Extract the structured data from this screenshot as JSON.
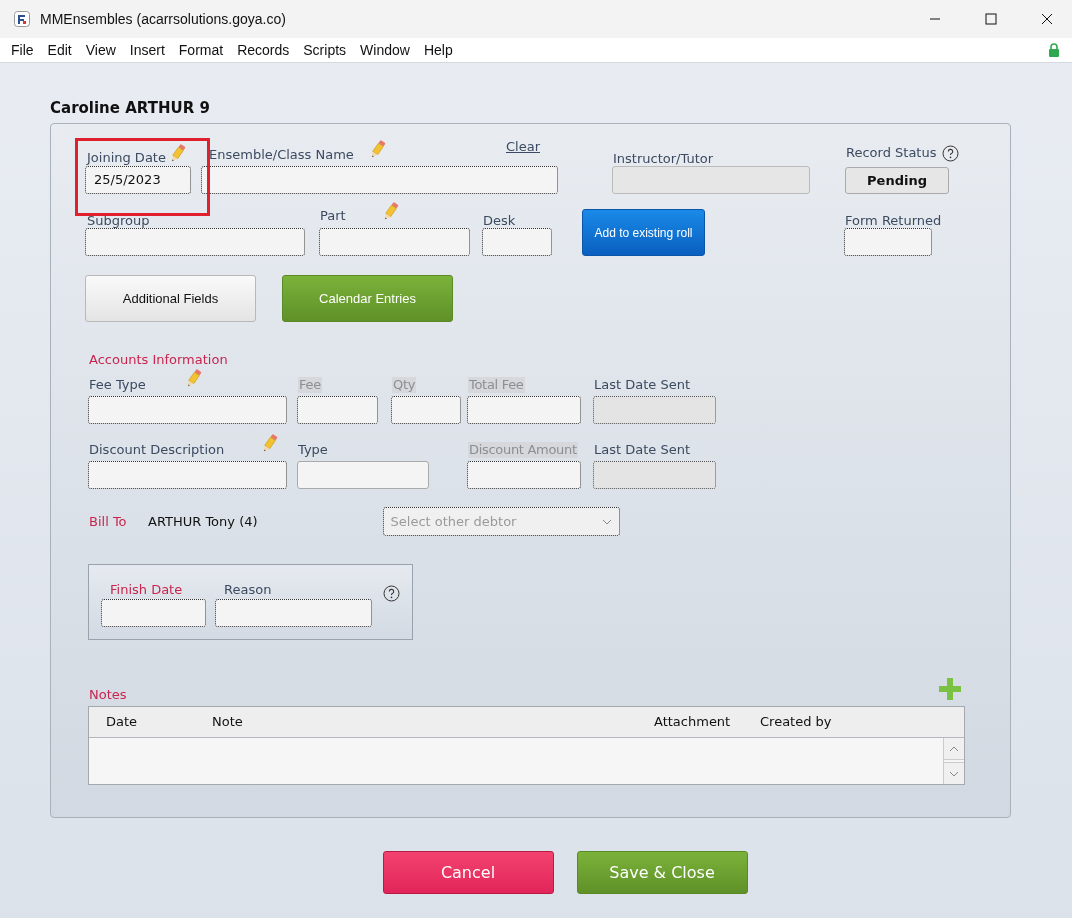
{
  "window": {
    "title": "MMEnsembles (acarrsolutions.goya.co)"
  },
  "menu": [
    "File",
    "Edit",
    "View",
    "Insert",
    "Format",
    "Records",
    "Scripts",
    "Window",
    "Help"
  ],
  "record_title": "Caroline ARTHUR 9",
  "enrolment": {
    "joining_date": {
      "label": "Joining Date",
      "value": "25/5/2023",
      "highlighted": true
    },
    "ensemble": {
      "label": "Ensemble/Class Name",
      "link": "Clear"
    },
    "instructor": {
      "label": "Instructor/Tutor"
    },
    "record_status": {
      "label": "Record Status",
      "value": "Pending"
    },
    "subgroup": {
      "label": "Subgroup"
    },
    "part": {
      "label": "Part"
    },
    "desk": {
      "label": "Desk"
    },
    "add_button": "Add to existing roll",
    "form_returned": {
      "label": "Form Returned"
    }
  },
  "buttons": [
    {
      "label": "Additional Fields",
      "kind": "plain"
    },
    {
      "label": "Calendar Entries",
      "kind": "green"
    }
  ],
  "accounts": {
    "heading": "Accounts Information",
    "fee_type": {
      "label": "Fee Type"
    },
    "fee": {
      "label": "Fee",
      "kind": "calc"
    },
    "qty": {
      "label": "Qty",
      "kind": "calc"
    },
    "total_fee": {
      "label": "Total Fee",
      "kind": "calc"
    },
    "fee_last_date_sent": {
      "label": "Last Date Sent",
      "kind": "readonly"
    },
    "discount_description": {
      "label": "Discount Description"
    },
    "discount_type": {
      "label": "Type",
      "kind": "select"
    },
    "discount_amount": {
      "label": "Discount Amount",
      "kind": "calc"
    },
    "discount_last_date_sent": {
      "label": "Last Date Sent",
      "kind": "readonly"
    }
  },
  "bill_to": {
    "label": "Bill To",
    "value": "ARTHUR Tony (4)",
    "dropdown_placeholder": "Select other debtor"
  },
  "finish": {
    "finish_date": {
      "label": "Finish Date"
    },
    "reason": {
      "label": "Reason"
    }
  },
  "notes": {
    "heading": "Notes",
    "columns": [
      "Date",
      "Note",
      "Attachment",
      "Created by"
    ]
  },
  "footer_buttons": [
    {
      "label": "Cancel",
      "kind": "danger"
    },
    {
      "label": "Save & Close",
      "kind": "primary"
    }
  ]
}
